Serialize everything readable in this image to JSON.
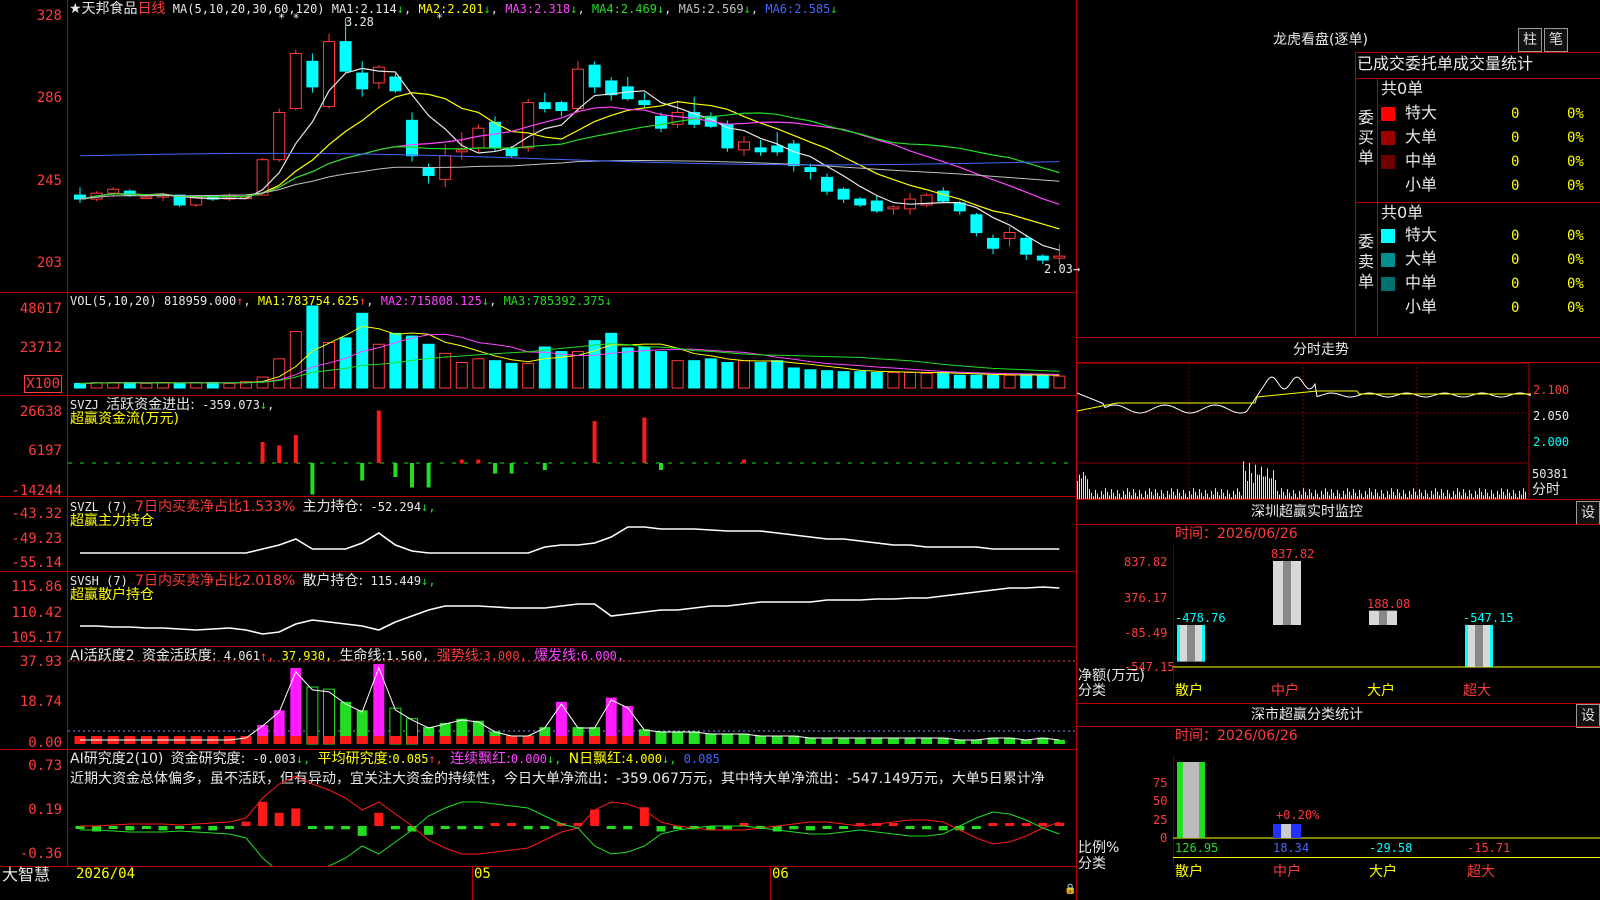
{
  "stock": {
    "name": "★天邦食品",
    "period": "日线",
    "ma_def": "MA(5,10,20,30,60,120)",
    "ma1_label": "MA1:",
    "ma1_val": "2.114",
    "ma1_arrow": "↓",
    "ma2_label": "MA2:",
    "ma2_val": "2.201",
    "ma2_arrow": "↓",
    "ma3_label": "MA3:",
    "ma3_val": "2.318",
    "ma3_arrow": "↓",
    "ma4_label": "MA4:",
    "ma4_val": "2.469",
    "ma4_arrow": "↓",
    "ma5_label": "MA5:",
    "ma5_val": "2.569",
    "ma5_arrow": "↓",
    "ma6_label": "MA6:",
    "ma6_val": "2.585",
    "ma6_arrow": "↓",
    "high_mark": "3.28",
    "low_mark": "2.03→",
    "star_marks": [
      "* *",
      "*"
    ]
  },
  "price_axis": [
    "328",
    "286",
    "245",
    "203"
  ],
  "vol": {
    "def": "VOL(5,10,20)",
    "vol_val": "818959.000",
    "vol_arrow": "↑",
    "ma1_label": "MA1:",
    "ma1_val": "783754.625",
    "ma1_arrow": "↑",
    "ma2_label": "MA2:",
    "ma2_val": "715808.125",
    "ma2_arrow": "↓",
    "ma3_label": "MA3:",
    "ma3_val": "785392.375",
    "ma3_arrow": "↓",
    "axis": [
      "48017",
      "23712",
      "X100"
    ]
  },
  "svzj": {
    "name": "SVZJ",
    "label": "活跃资金进出:",
    "val": "-359.073",
    "arrow": "↓",
    "sub": "超赢资金流(万元)",
    "axis": [
      "26638",
      "6197",
      "-14244"
    ]
  },
  "svzl": {
    "name": "SVZL (7)",
    "label1": "7日内买卖净占比1.533%",
    "label2": "主力持仓:",
    "val": "-52.294",
    "arrow": "↓,",
    "sub": "超赢主力持仓",
    "axis": [
      "-43.32",
      "-49.23",
      "-55.14"
    ]
  },
  "svsh": {
    "name": "SVSH (7)",
    "label1": "7日内买卖净占比2.018%",
    "label2": "散户持仓:",
    "val": "115.449",
    "arrow": "↓,",
    "sub": "超赢散户持仓",
    "axis": [
      "115.86",
      "110.42",
      "105.17"
    ]
  },
  "ai_active": {
    "name": "AI活跃度2",
    "label": "资金活跃度:",
    "val": "4.061",
    "arrow": "↑,",
    "val2": "37.930,",
    "life_label": "生命线:",
    "life_val": "1.560,",
    "strong_label": "强势线:",
    "strong_val": "3.000,",
    "burst_label": "爆发线:",
    "burst_val": "6.000,",
    "axis": [
      "37.93",
      "18.74",
      "0.00"
    ]
  },
  "ai_research": {
    "name": "AI研究度2(10)",
    "label": "资金研究度:",
    "val": "-0.003",
    "arrow": "↓,",
    "avg_label": "平均研究度:",
    "avg_val": "0.085",
    "avg_arrow": "↑,",
    "red_label": "连续飘红:",
    "red_val": "0.000",
    "red_arrow": "↓,",
    "n_label": "N日飘红:",
    "n_val": "4.000",
    "n_arrow": "↓,",
    "last_val": "0.085",
    "comment": "近期大资金总体偏多，虽不活跃，但有异动，宜关注大资金的持续性，今日大单净流出：-359.067万元，其中特大单净流出：-547.149万元，大单5日累计净",
    "axis": [
      "0.73",
      "0.19",
      "-0.36"
    ]
  },
  "bottom": {
    "logo": "大智慧",
    "dates": [
      "2026/04",
      "05",
      "06"
    ]
  },
  "dragon": {
    "title": "龙虎看盘(逐单)",
    "btn1": "柱",
    "btn2": "笔",
    "subtitle": "已成交委托单成交量统计",
    "buy_total": "共0单",
    "buy_label": "委买单",
    "sell_total": "共0单",
    "sell_label": "委卖单",
    "buy_rows": [
      {
        "name": "特大",
        "n": "0",
        "p": "0%",
        "color": "#ff0000"
      },
      {
        "name": "大单",
        "n": "0",
        "p": "0%",
        "color": "#a00000"
      },
      {
        "name": "中单",
        "n": "0",
        "p": "0%",
        "color": "#700000"
      },
      {
        "name": "小单",
        "n": "0",
        "p": "0%",
        "color": "#000000"
      }
    ],
    "sell_rows": [
      {
        "name": "特大",
        "n": "0",
        "p": "0%",
        "color": "#00ffff"
      },
      {
        "name": "大单",
        "n": "0",
        "p": "0%",
        "color": "#009090"
      },
      {
        "name": "中单",
        "n": "0",
        "p": "0%",
        "color": "#007070"
      },
      {
        "name": "小单",
        "n": "0",
        "p": "0%",
        "color": "#000000"
      }
    ]
  },
  "intraday": {
    "title": "分时走势",
    "axis": [
      "2.100",
      "2.050",
      "2.000"
    ],
    "vol_axis": [
      "50381",
      "分时"
    ]
  },
  "monitor": {
    "title": "深圳超赢实时监控",
    "btn": "设",
    "time_label": "时间：2026/06/26",
    "axis": [
      "837.82",
      "376.17",
      "-85.49",
      "-547.15"
    ],
    "unit1": "净额(万元)",
    "unit2": "分类",
    "categories": [
      "散户",
      "中户",
      "大户",
      "超大"
    ],
    "values": [
      -478.76,
      837.82,
      188.08,
      -547.15
    ],
    "value_labels": [
      "-478.76",
      "837.82",
      "188.08",
      "-547.15"
    ]
  },
  "stat": {
    "title": "深市超赢分类统计",
    "btn": "设",
    "time_label": "时间：2026/06/26",
    "axis": [
      "75",
      "50",
      "25",
      "0"
    ],
    "unit1": "比例%",
    "unit2": "分类",
    "pct_label": "+0.20%",
    "categories": [
      "散户",
      "中户",
      "大户",
      "超大"
    ],
    "value_labels": [
      "126.95",
      "18.34",
      "-29.58",
      "-15.71"
    ]
  },
  "chart_data": [
    {
      "type": "candlestick",
      "title": "★天邦食品 日线",
      "ylim": [
        2.03,
        3.28
      ],
      "ohlc": [
        [
          2.38,
          2.42,
          2.34,
          2.36
        ],
        [
          2.36,
          2.4,
          2.35,
          2.39
        ],
        [
          2.39,
          2.42,
          2.37,
          2.41
        ],
        [
          2.4,
          2.41,
          2.37,
          2.38
        ],
        [
          2.37,
          2.38,
          2.36,
          2.37
        ],
        [
          2.37,
          2.39,
          2.35,
          2.38
        ],
        [
          2.38,
          2.38,
          2.32,
          2.33
        ],
        [
          2.33,
          2.38,
          2.32,
          2.37
        ],
        [
          2.37,
          2.38,
          2.35,
          2.36
        ],
        [
          2.36,
          2.39,
          2.35,
          2.38
        ],
        [
          2.37,
          2.38,
          2.36,
          2.37
        ],
        [
          2.38,
          2.57,
          2.38,
          2.56
        ],
        [
          2.56,
          2.82,
          2.55,
          2.8
        ],
        [
          2.82,
          3.12,
          2.81,
          3.1
        ],
        [
          3.06,
          3.1,
          2.9,
          2.93
        ],
        [
          2.83,
          3.2,
          2.82,
          3.16
        ],
        [
          3.16,
          3.28,
          3.0,
          3.01
        ],
        [
          3.0,
          3.06,
          2.88,
          2.92
        ],
        [
          2.95,
          3.04,
          2.92,
          3.03
        ],
        [
          2.98,
          3.0,
          2.9,
          2.91
        ],
        [
          2.76,
          2.8,
          2.55,
          2.58
        ],
        [
          2.52,
          2.54,
          2.44,
          2.48
        ],
        [
          2.46,
          2.64,
          2.42,
          2.58
        ],
        [
          2.6,
          2.7,
          2.56,
          2.61
        ],
        [
          2.62,
          2.74,
          2.6,
          2.72
        ],
        [
          2.75,
          2.78,
          2.6,
          2.62
        ],
        [
          2.62,
          2.63,
          2.57,
          2.58
        ],
        [
          2.62,
          2.87,
          2.6,
          2.85
        ],
        [
          2.85,
          2.9,
          2.8,
          2.82
        ],
        [
          2.85,
          2.86,
          2.78,
          2.81
        ],
        [
          2.82,
          3.06,
          2.8,
          3.02
        ],
        [
          3.04,
          3.06,
          2.9,
          2.93
        ],
        [
          2.96,
          2.98,
          2.86,
          2.89
        ],
        [
          2.93,
          2.98,
          2.86,
          2.87
        ],
        [
          2.86,
          2.9,
          2.82,
          2.84
        ],
        [
          2.78,
          2.8,
          2.7,
          2.72
        ],
        [
          2.74,
          2.86,
          2.72,
          2.8
        ],
        [
          2.8,
          2.88,
          2.72,
          2.74
        ],
        [
          2.78,
          2.8,
          2.72,
          2.73
        ],
        [
          2.74,
          2.76,
          2.6,
          2.62
        ],
        [
          2.61,
          2.68,
          2.58,
          2.65
        ],
        [
          2.62,
          2.66,
          2.58,
          2.6
        ],
        [
          2.63,
          2.7,
          2.58,
          2.6
        ],
        [
          2.64,
          2.66,
          2.5,
          2.53
        ],
        [
          2.52,
          2.54,
          2.46,
          2.5
        ],
        [
          2.47,
          2.49,
          2.38,
          2.4
        ],
        [
          2.41,
          2.42,
          2.34,
          2.36
        ],
        [
          2.36,
          2.37,
          2.32,
          2.33
        ],
        [
          2.35,
          2.38,
          2.29,
          2.3
        ],
        [
          2.31,
          2.33,
          2.28,
          2.32
        ],
        [
          2.31,
          2.39,
          2.28,
          2.36
        ],
        [
          2.33,
          2.39,
          2.32,
          2.38
        ],
        [
          2.4,
          2.42,
          2.34,
          2.35
        ],
        [
          2.34,
          2.35,
          2.28,
          2.3
        ],
        [
          2.28,
          2.29,
          2.17,
          2.19
        ],
        [
          2.16,
          2.18,
          2.08,
          2.11
        ],
        [
          2.16,
          2.22,
          2.12,
          2.19
        ],
        [
          2.16,
          2.18,
          2.05,
          2.08
        ],
        [
          2.07,
          2.08,
          2.03,
          2.05
        ],
        [
          2.06,
          2.13,
          2.03,
          2.07
        ]
      ],
      "ma_lines": {
        "MA1": "2.114",
        "MA2": "2.201",
        "MA3": "2.318",
        "MA4": "2.469",
        "MA5": "2.569",
        "MA6": "2.585"
      }
    },
    {
      "type": "bar",
      "title": "VOL",
      "ylim": [
        0,
        48017
      ],
      "values": [
        5,
        6,
        6,
        6,
        5,
        6,
        5,
        6,
        6,
        5,
        7,
        12,
        32,
        62,
        90,
        50,
        55,
        82,
        48,
        60,
        57,
        48,
        38,
        28,
        32,
        30,
        27,
        27,
        45,
        40,
        40,
        52,
        60,
        44,
        45,
        40,
        30,
        30,
        32,
        28,
        30,
        28,
        30,
        22,
        20,
        19,
        18,
        18,
        17,
        17,
        17,
        16,
        17,
        14,
        14,
        14,
        14,
        15,
        14,
        13
      ]
    },
    {
      "type": "bar",
      "title": "SVZJ 活跃资金进出",
      "ylim": [
        -14244,
        26638
      ],
      "values": [
        -1,
        -1,
        -1,
        -1,
        -1,
        -1,
        -1,
        -1,
        -1,
        -1,
        -1,
        6,
        5,
        8,
        -9,
        -1,
        -1,
        -5,
        15,
        -4,
        -7,
        -7,
        -1,
        1,
        1,
        -3,
        -3,
        -1,
        -2,
        -1,
        -1,
        12,
        -1,
        -1,
        13,
        -2,
        -1,
        -1,
        -1,
        -1,
        1,
        -1,
        -1,
        -1,
        -1,
        -1,
        -1,
        -1,
        -1,
        -1,
        -1,
        -1,
        -1,
        -1,
        -1,
        -1,
        -1,
        -1,
        -1,
        -1
      ]
    },
    {
      "type": "bar",
      "title": "AI活跃度2",
      "ylim": [
        0,
        37.93
      ],
      "values": [
        2,
        2,
        2,
        2,
        2,
        2,
        2,
        2,
        2,
        2,
        3,
        9,
        16,
        36,
        27,
        26,
        20,
        16,
        38,
        17,
        12,
        8,
        10,
        12,
        11,
        6,
        4,
        4,
        8,
        20,
        8,
        8,
        22,
        18,
        7,
        6,
        6,
        6,
        5,
        5,
        5,
        4,
        4,
        4,
        3,
        3,
        3,
        3,
        3,
        3,
        3,
        3,
        3,
        2,
        2,
        3,
        3,
        2,
        3,
        2
      ]
    },
    {
      "type": "bar",
      "title": "AI研究度2(10)",
      "ylim": [
        -0.36,
        0.73
      ],
      "values": [
        -0.02,
        -0.05,
        -0.02,
        -0.04,
        -0.02,
        -0.04,
        -0.02,
        -0.03,
        -0.04,
        -0.02,
        0.04,
        0.22,
        0.12,
        0.16,
        -0.02,
        -0.03,
        -0.03,
        -0.09,
        0.12,
        -0.03,
        -0.05,
        -0.08,
        -0.02,
        -0.03,
        -0.02,
        0.01,
        0.02,
        -0.03,
        -0.02,
        0.02,
        0.02,
        0.15,
        -0.01,
        -0.03,
        0.17,
        -0.05,
        -0.02,
        -0.03,
        -0.04,
        -0.03,
        0.01,
        -0.02,
        -0.05,
        -0.03,
        -0.04,
        -0.02,
        -0.02,
        0.02,
        0.02,
        0.02,
        -0.02,
        -0.03,
        -0.04,
        -0.04,
        -0.02,
        0.02,
        0.02,
        0.02,
        0.02,
        0.03
      ]
    },
    {
      "type": "bar",
      "title": "深圳超赢实时监控",
      "categories": [
        "散户",
        "中户",
        "大户",
        "超大"
      ],
      "values": [
        -478.76,
        837.82,
        188.08,
        -547.15
      ],
      "ylim": [
        -547.15,
        837.82
      ]
    }
  ]
}
